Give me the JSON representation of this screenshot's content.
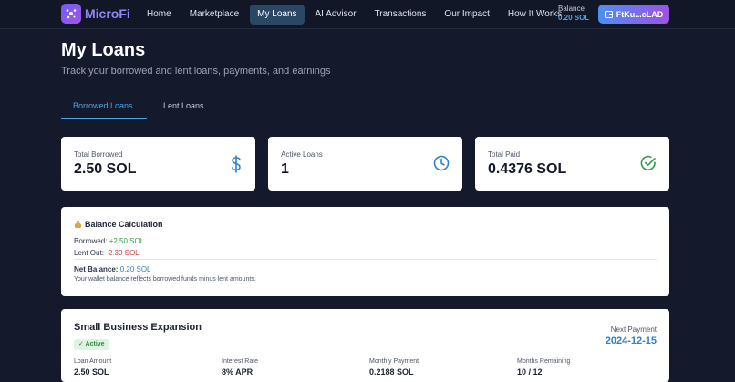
{
  "app": {
    "name": "MicroFi"
  },
  "nav": {
    "items": [
      {
        "label": "Home",
        "active": false
      },
      {
        "label": "Marketplace",
        "active": false
      },
      {
        "label": "My Loans",
        "active": true
      },
      {
        "label": "AI Advisor",
        "active": false
      },
      {
        "label": "Transactions",
        "active": false
      },
      {
        "label": "Our Impact",
        "active": false
      },
      {
        "label": "How It Works",
        "active": false
      }
    ],
    "balance_label": "Balance",
    "balance_value": "0.20 SOL",
    "wallet_label": "FtKu...cLAD"
  },
  "page": {
    "title": "My Loans",
    "subtitle": "Track your borrowed and lent loans, payments, and earnings"
  },
  "tabs": [
    {
      "label": "Borrowed Loans",
      "active": true
    },
    {
      "label": "Lent Loans",
      "active": false
    }
  ],
  "stats": [
    {
      "label": "Total Borrowed",
      "value": "2.50 SOL",
      "icon": "dollar-icon",
      "color": "#2f80c9"
    },
    {
      "label": "Active Loans",
      "value": "1",
      "icon": "clock-icon",
      "color": "#2f80c9"
    },
    {
      "label": "Total Paid",
      "value": "0.4376 SOL",
      "icon": "check-circle-icon",
      "color": "#2f9a4a"
    }
  ],
  "balance_calc": {
    "title": "Balance Calculation",
    "borrowed_label": "Borrowed:",
    "borrowed_value": "+2.50 SOL",
    "lent_label": "Lent Out:",
    "lent_value": "-2.30 SOL",
    "net_label": "Net Balance:",
    "net_value": "0.20 SOL",
    "note": "Your wallet balance reflects borrowed funds minus lent amounts."
  },
  "loan": {
    "title": "Small Business Expansion",
    "status": "✓ Active",
    "next_payment_label": "Next Payment",
    "next_payment_date": "2024-12-15",
    "metrics": [
      {
        "label": "Loan Amount",
        "value": "2.50 SOL"
      },
      {
        "label": "Interest Rate",
        "value": "8% APR"
      },
      {
        "label": "Monthly Payment",
        "value": "0.2188 SOL"
      },
      {
        "label": "Months Remaining",
        "value": "10 / 12"
      }
    ]
  },
  "colors": {
    "background": "#141a2b",
    "accent": "#4aa3e8",
    "success": "#2f9a4a",
    "danger": "#d33a3a"
  }
}
